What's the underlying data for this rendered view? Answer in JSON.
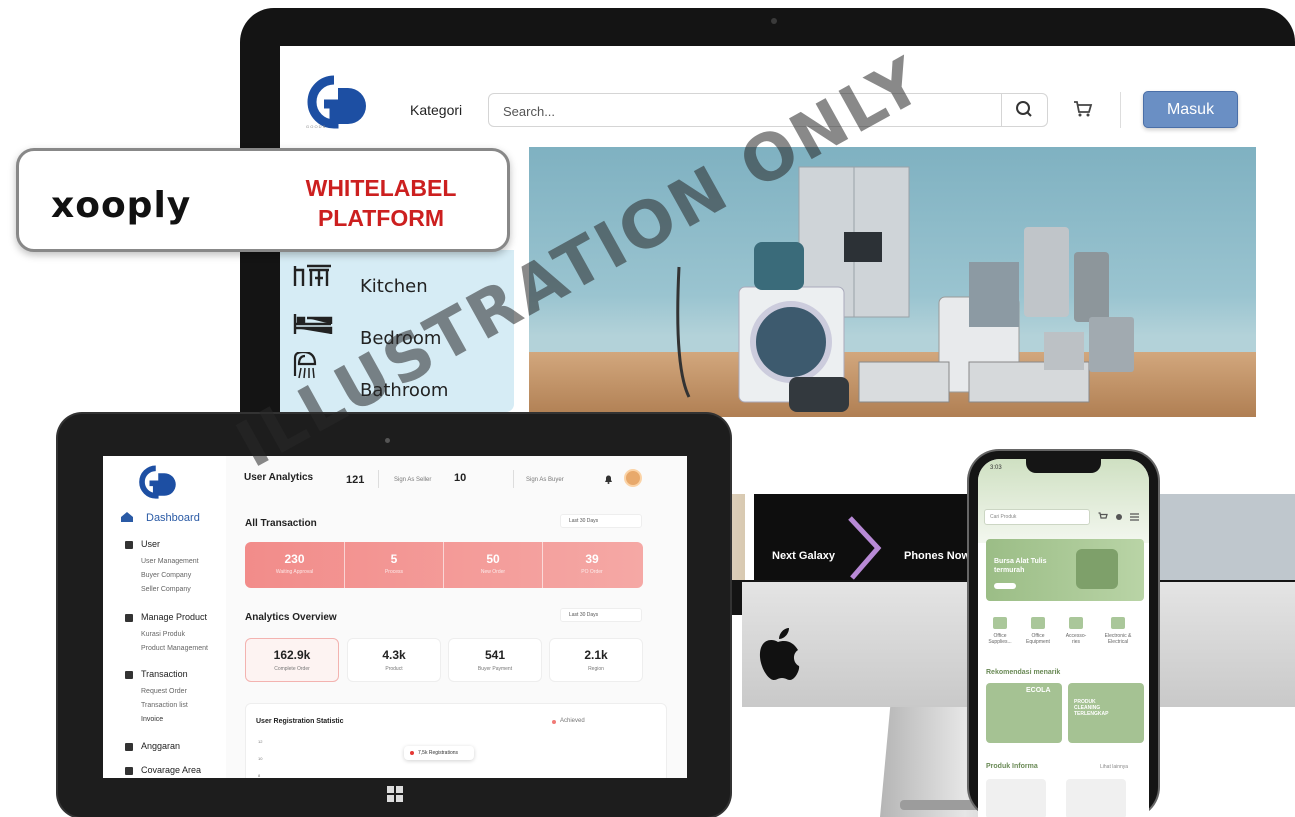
{
  "brand": {
    "badge_logo": "xooply",
    "badge_title": "WHITELABEL PLATFORM"
  },
  "desktop": {
    "logo": "GD GOODS",
    "nav": {
      "kategori": "Kategori",
      "search_placeholder": "Search...",
      "login_label": "Masuk"
    },
    "categories": [
      {
        "label": "Kitchen",
        "icon": "kitchen-icon"
      },
      {
        "label": "Bedroom",
        "icon": "bed-icon"
      },
      {
        "label": "Bathroom",
        "icon": "shower-icon"
      }
    ],
    "banners": [
      {
        "label": "Next Galaxy"
      },
      {
        "label": "Phones Now"
      }
    ]
  },
  "tablet": {
    "sidebar": {
      "dashboard": "Dashboard",
      "user": "User",
      "user_items": [
        "User Management",
        "Buyer Company",
        "Seller Company"
      ],
      "manage_product": "Manage Product",
      "product_items": [
        "Kurasi Produk",
        "Product Management"
      ],
      "transaction": "Transaction",
      "transaction_items": [
        "Request Order",
        "Transaction list",
        "Invoice"
      ],
      "anggaran": "Anggaran",
      "coverage": "Covarage Area"
    },
    "header": {
      "title": "User Analytics",
      "seller_count": "121",
      "seller_label": "Sign As Seller",
      "buyer_count": "10",
      "buyer_label": "Sign As Buyer"
    },
    "all_transaction": {
      "title": "All Transaction",
      "filter": "Last 30 Days",
      "stats": [
        {
          "value": "230",
          "label": "Waiting Approval"
        },
        {
          "value": "5",
          "label": "Process"
        },
        {
          "value": "50",
          "label": "New Order"
        },
        {
          "value": "39",
          "label": "PO Order"
        }
      ]
    },
    "analytics": {
      "title": "Analytics Overview",
      "filter": "Last 30 Days",
      "cards": [
        {
          "value": "162.9k",
          "label": "Complete Order"
        },
        {
          "value": "4.3k",
          "label": "Product"
        },
        {
          "value": "541",
          "label": "Buyer Payment"
        },
        {
          "value": "2.1k",
          "label": "Region"
        }
      ]
    },
    "registration": {
      "title": "User Registration Statistic",
      "legend": "Achieved",
      "tooltip": "7,5k Registrations",
      "ticks": [
        "12",
        "10",
        "8"
      ]
    }
  },
  "phone": {
    "time": "3:03",
    "search_placeholder": "Cari Produk",
    "banner_title": "Bursa Alat Tulis termurah",
    "categories": [
      "Office Supplies...",
      "Office Equipment",
      "Accesso-ries",
      "Electronic & Electrical"
    ],
    "rekomendasi": "Rekomendasi menarik",
    "promo": [
      "ECOLA",
      "PRODUK CLEANING TERLENGKAP"
    ],
    "produk_informa": "Produk Informa",
    "lihat_semua": "Lihat lainnya"
  },
  "watermark": "ILLUSTRATION ONLY"
}
